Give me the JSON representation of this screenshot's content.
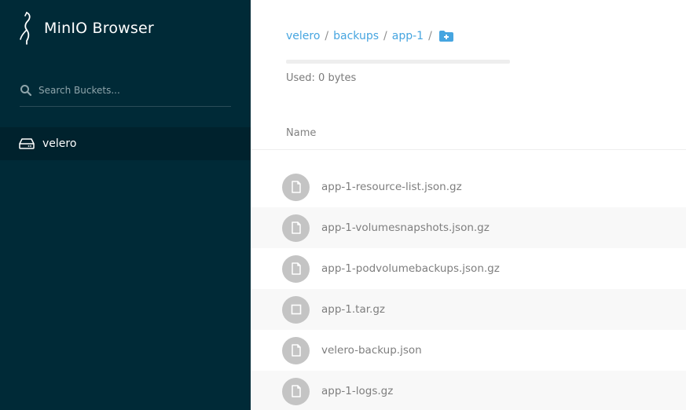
{
  "app": {
    "title": "MinIO Browser"
  },
  "sidebar": {
    "search": {
      "placeholder": "Search Buckets..."
    },
    "buckets": [
      {
        "name": "velero",
        "icon": "drive-icon"
      }
    ]
  },
  "breadcrumb": {
    "items": [
      "velero",
      "backups",
      "app-1"
    ],
    "separator": "/",
    "action_icon": "folder-plus-icon"
  },
  "storage": {
    "used_label": "Used: 0 bytes",
    "usage_fraction": 0
  },
  "table": {
    "header": "Name",
    "files": [
      {
        "name": "app-1-resource-list.json.gz",
        "icon": "file-icon"
      },
      {
        "name": "app-1-volumesnapshots.json.gz",
        "icon": "file-icon"
      },
      {
        "name": "app-1-podvolumebackups.json.gz",
        "icon": "file-icon"
      },
      {
        "name": "app-1.tar.gz",
        "icon": "archive-icon"
      },
      {
        "name": "velero-backup.json",
        "icon": "file-icon"
      },
      {
        "name": "app-1-logs.gz",
        "icon": "file-icon"
      }
    ]
  },
  "colors": {
    "sidebar_bg": "#002a37",
    "accent": "#46a5e0",
    "text_muted": "#7e7e7e"
  }
}
